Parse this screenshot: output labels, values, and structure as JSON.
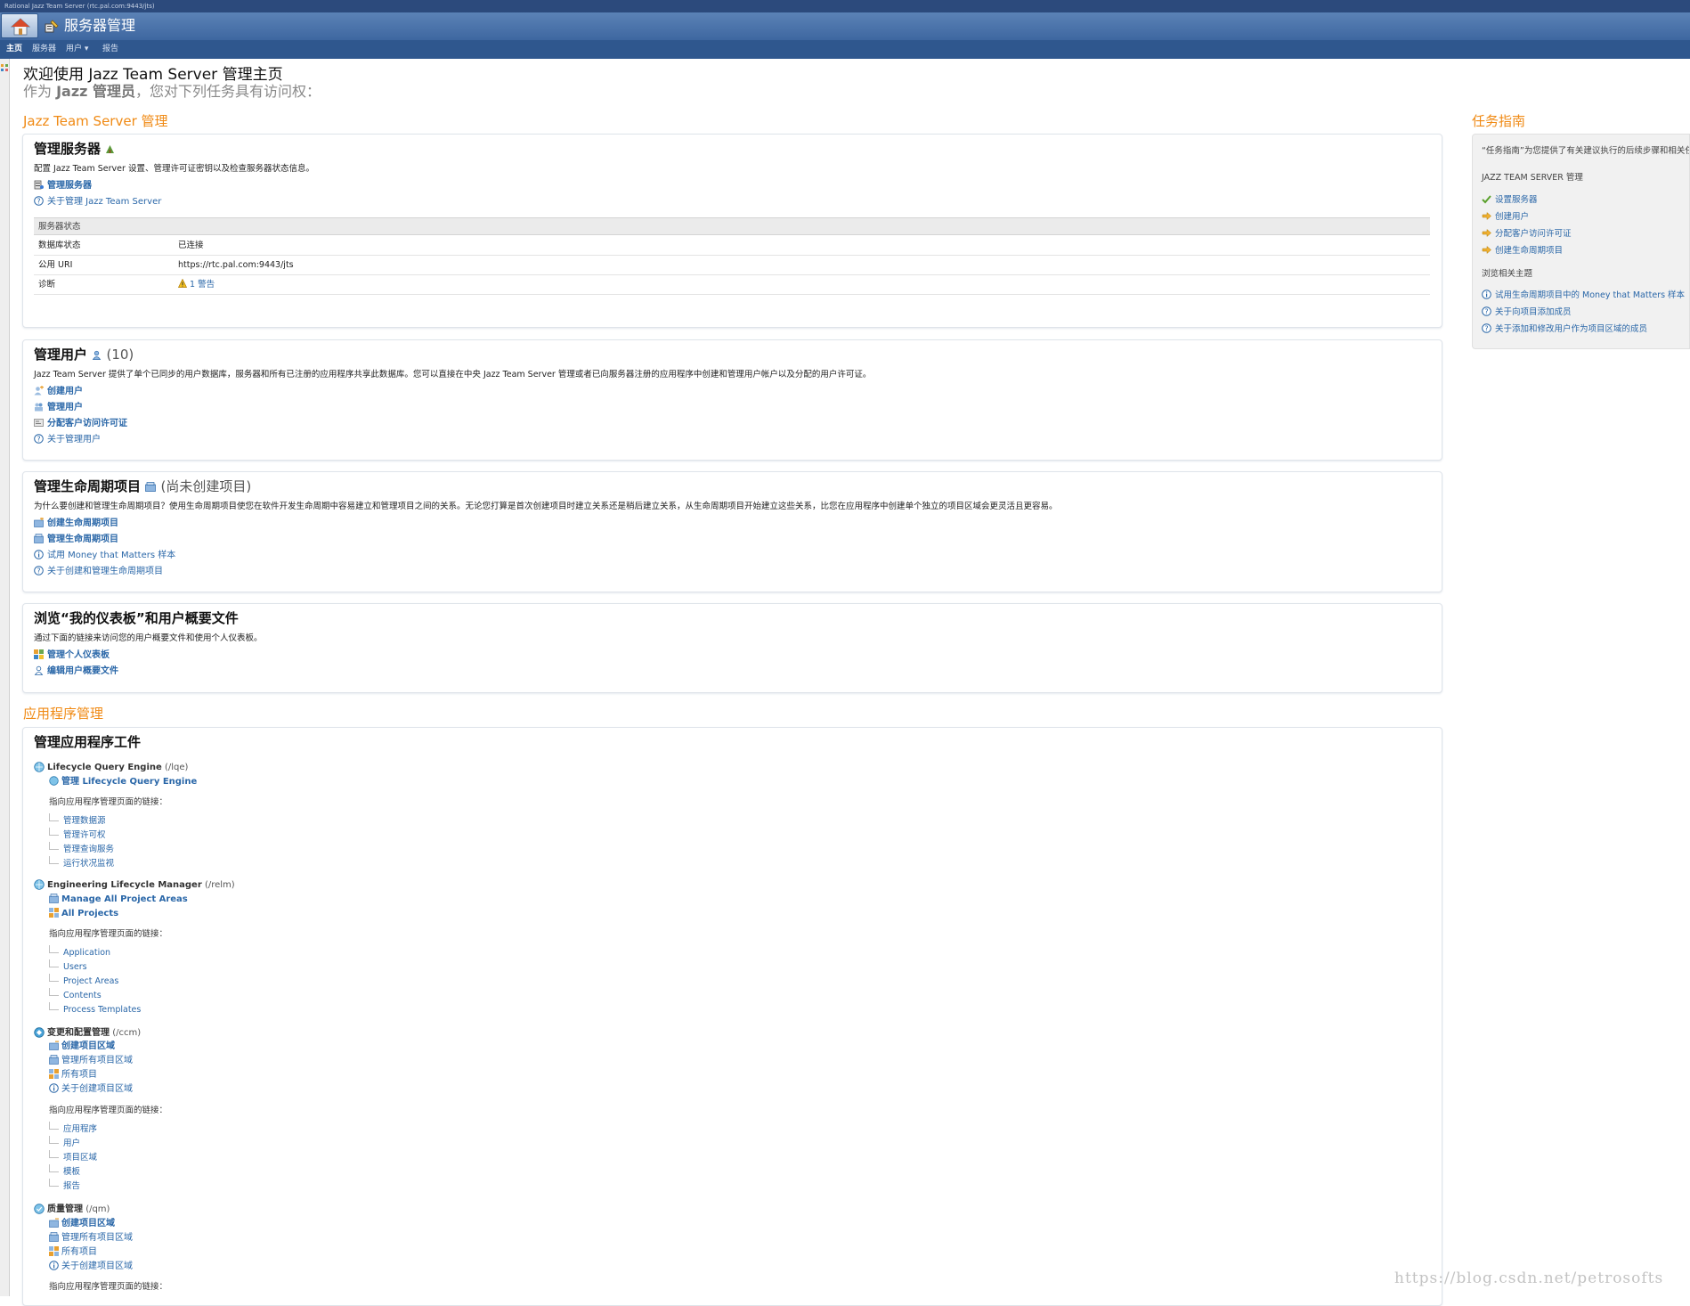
{
  "window": {
    "title": "Rational Jazz Team Server (rtc.pal.com:9443/jts)"
  },
  "banner": {
    "title": "服务器管理"
  },
  "nav": {
    "home": "主页",
    "server": "服务器",
    "users": "用户 ▾",
    "reports": "报告"
  },
  "welcome": {
    "title": "欢迎使用 Jazz Team Server 管理主页",
    "sub_prefix": "作为 ",
    "sub_role": "Jazz 管理员",
    "sub_suffix": "，您对下列任务具有访问权："
  },
  "sections": {
    "jts": "Jazz Team Server 管理",
    "apps": "应用程序管理"
  },
  "server_panel": {
    "title": "管理服务器",
    "desc": "配置 Jazz Team Server 设置、管理许可证密钥以及检查服务器状态信息。",
    "links": [
      "管理服务器",
      "关于管理 Jazz Team Server"
    ],
    "status_header": "服务器状态",
    "rows": [
      {
        "k": "数据库状态",
        "v": "已连接"
      },
      {
        "k": "公用 URI",
        "v": "https://rtc.pal.com:9443/jts"
      },
      {
        "k": "诊断",
        "v": "1 警告"
      }
    ]
  },
  "users_panel": {
    "title": "管理用户",
    "count": "(10)",
    "desc": "Jazz Team Server 提供了单个已同步的用户数据库，服务器和所有已注册的应用程序共享此数据库。您可以直接在中央 Jazz Team Server 管理或者已向服务器注册的应用程序中创建和管理用户帐户以及分配的用户许可证。",
    "links": [
      "创建用户",
      "管理用户",
      "分配客户访问许可证",
      "关于管理用户"
    ]
  },
  "lifecycle_panel": {
    "title": "管理生命周期项目",
    "count": "(尚未创建项目)",
    "desc": "为什么要创建和管理生命周期项目？使用生命周期项目使您在软件开发生命周期中容易建立和管理项目之间的关系。无论您打算是首次创建项目时建立关系还是稍后建立关系，从生命周期项目开始建立这些关系，比您在应用程序中创建单个独立的项目区域会更灵活且更容易。",
    "links": [
      "创建生命周期项目",
      "管理生命周期项目",
      "试用 Money that Matters 样本",
      "关于创建和管理生命周期项目"
    ]
  },
  "dash_panel": {
    "title": "浏览“我的仪表板”和用户概要文件",
    "desc": "通过下面的链接来访问您的用户概要文件和使用个人仪表板。",
    "links": [
      "管理个人仪表板",
      "编辑用户概要文件"
    ]
  },
  "apps_panel": {
    "title": "管理应用程序工件",
    "apps": [
      {
        "name": "Lifecycle Query Engine",
        "path": "(/lqe)",
        "links": [
          "管理 Lifecycle Query Engine"
        ],
        "hint": "指向应用程序管理页面的链接：",
        "tree": [
          "管理数据源",
          "管理许可权",
          "管理查询服务",
          "运行状况监视"
        ]
      },
      {
        "name": "Engineering Lifecycle Manager",
        "path": "(/relm)",
        "links": [
          "Manage All Project Areas",
          "All Projects"
        ],
        "hint": "指向应用程序管理页面的链接：",
        "tree": [
          "Application",
          "Users",
          "Project Areas",
          "Contents",
          "Process Templates"
        ]
      },
      {
        "name": "变更和配置管理",
        "path": "(/ccm)",
        "links": [
          "创建项目区域",
          "管理所有项目区域",
          "所有项目",
          "关于创建项目区域"
        ],
        "hint": "指向应用程序管理页面的链接：",
        "tree": [
          "应用程序",
          "用户",
          "项目区域",
          "模板",
          "报告"
        ]
      },
      {
        "name": "质量管理",
        "path": "(/qm)",
        "links": [
          "创建项目区域",
          "管理所有项目区域",
          "所有项目",
          "关于创建项目区域"
        ],
        "hint": "指向应用程序管理页面的链接："
      }
    ]
  },
  "task_guide": {
    "title": "任务指南",
    "intro": "“任务指南”为您提供了有关建议执行的后续步骤和相关任",
    "group1": "JAZZ TEAM SERVER 管理",
    "steps": [
      "设置服务器",
      "创建用户",
      "分配客户访问许可证",
      "创建生命周期项目"
    ],
    "group2": "浏览相关主题",
    "topics": [
      "试用生命周期项目中的 Money that Matters 样本",
      "关于向项目添加成员",
      "关于添加和修改用户作为项目区域的成员"
    ]
  },
  "watermark": "https://blog.csdn.net/petrosofts",
  "colors": {
    "accent": "#f08a14",
    "link": "#2a67a8",
    "banner": "#3e67a0"
  }
}
